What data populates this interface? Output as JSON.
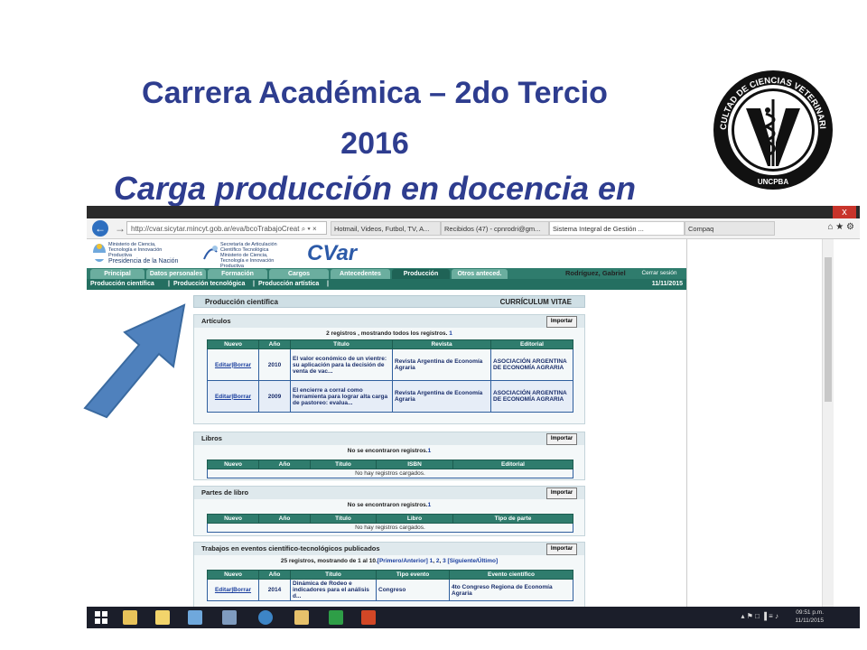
{
  "slide": {
    "title_line1": "Carrera Académica – 2do Tercio",
    "title_line2": "2016",
    "title_line3": "Carga producción en docencia en"
  },
  "seal": {
    "top_text": "FACULTAD DE CIENCIAS VETERINARIAS",
    "bottom_text": "UNCPBA"
  },
  "browser": {
    "close_label": "x",
    "url": "http://cvar.sicytar.mincyt.gob.ar/eva/bcoTrabajoCreat",
    "url_suffix": "⌕ ▾ ×",
    "tabs": [
      {
        "label": "Hotmail, Videos, Futbol, TV, A...",
        "active": false
      },
      {
        "label": "Recibidos (47) - cpnrodri@gm...",
        "active": false
      },
      {
        "label": "Sistema Integral de Gestión ...",
        "active": true
      },
      {
        "label": "Compaq",
        "active": false
      }
    ],
    "icons": "⌂ ★ ⚙"
  },
  "site": {
    "ministry_text": "Ministerio de Ciencia, Tecnología e Innovación Productiva",
    "presidency_text": "Presidencia de la Nación",
    "secretaria_text": "Secretaría de Articulación Científico Tecnológica",
    "ministry2_text": "Ministerio de Ciencia, Tecnología e Innovación Productiva",
    "logo_text": "CVar",
    "main_tabs": [
      "Principal",
      "Datos personales",
      "Formación",
      "Cargos",
      "Antecedentes",
      "Producción",
      "Otros anteced."
    ],
    "active_tab": "Producción",
    "user_name": "Rodríguez, Gabriel",
    "logout_label": "Cerrar sesión",
    "sub_tabs": [
      "Producción científica",
      "Producción tecnológica",
      "Producción artística"
    ],
    "date": "11/11/2015",
    "section_title": "Producción científica",
    "section_right": "CURRÍCULUM VITAE"
  },
  "panels": {
    "articulos": {
      "title": "Artículos",
      "import_label": "Importar",
      "records_text": "2 registros , mostrando todos los registros.",
      "records_page": "1",
      "headers": [
        "Nuevo",
        "Año",
        "Título",
        "Revista",
        "Editorial"
      ],
      "rows": [
        {
          "action": "Editar|Borrar",
          "year": "2010",
          "title": "El valor económico de un vientre: su aplicación para la decisión de venta de vac...",
          "journal": "Revista Argentina de Economía Agraria",
          "publisher": "ASOCIACIÓN ARGENTINA DE ECONOMÍA AGRARIA"
        },
        {
          "action": "Editar|Borrar",
          "year": "2009",
          "title": "El encierre a corral como herramienta para lograr alta carga de pastoreo: evalua...",
          "journal": "Revista Argentina de Economía Agraria",
          "publisher": "ASOCIACIÓN ARGENTINA DE ECONOMÍA AGRARIA"
        }
      ]
    },
    "libros": {
      "title": "Libros",
      "import_label": "Importar",
      "records_text": "No se encontraron registros.",
      "records_page": "1",
      "headers": [
        "Nuevo",
        "Año",
        "Título",
        "ISBN",
        "Editorial"
      ],
      "empty_text": "No hay registros cargados."
    },
    "partes": {
      "title": "Partes de libro",
      "import_label": "Importar",
      "records_text": "No se encontraron registros.",
      "records_page": "1",
      "headers": [
        "Nuevo",
        "Año",
        "Título",
        "Libro",
        "Tipo de parte"
      ],
      "empty_text": "No hay registros cargados."
    },
    "eventos": {
      "title": "Trabajos en eventos científico-tecnológicos publicados",
      "import_label": "Importar",
      "records_text": "25 registros, mostrando de 1 al 10.",
      "nav_text": "[Primero/Anterior]",
      "pages": [
        "1",
        "2",
        "3"
      ],
      "next_text": "[Siguiente/Último]",
      "headers": [
        "Nuevo",
        "Año",
        "Título",
        "Tipo evento",
        "Evento científico"
      ],
      "rows": [
        {
          "action": "Editar|Borrar",
          "year": "2014",
          "title": "Dinámica de Rodeo e indicadores para el análisis d...",
          "type": "Congreso",
          "event": "4to Congreso Regiona de Economía Agraria"
        }
      ]
    }
  },
  "taskbar": {
    "time": "09:51 p.m.",
    "date": "11/11/2015",
    "tray_icons": "▴ ⚑ □ ▐ ≡ ♪"
  },
  "colors": {
    "title": "#2e3d8f",
    "nav_green": "#2f7c6d",
    "arrow_blue": "#4f81bd"
  }
}
